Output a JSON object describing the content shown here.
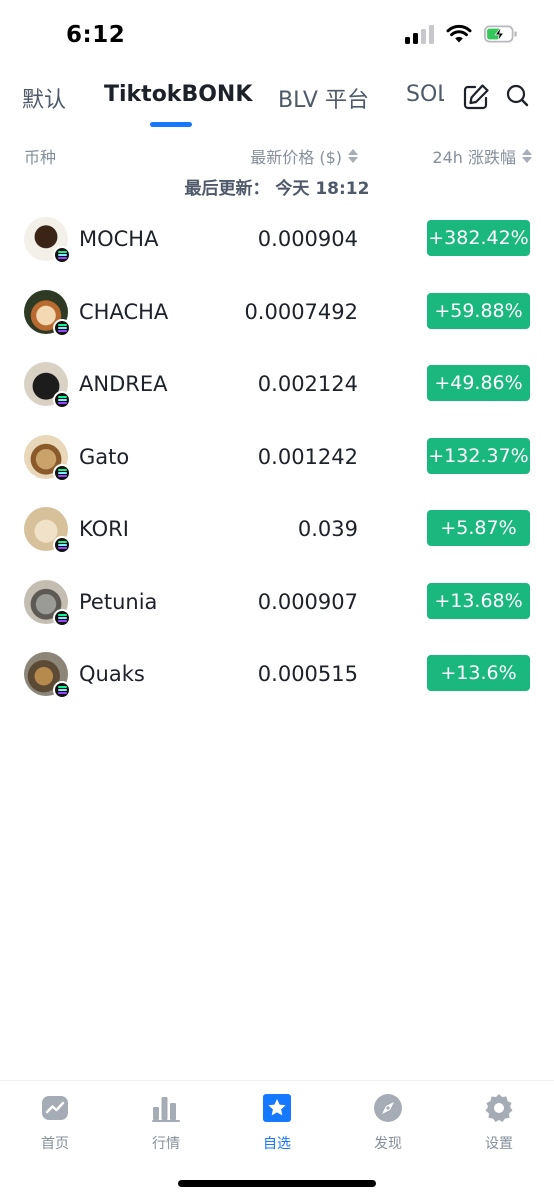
{
  "status_bar": {
    "time": "6:12"
  },
  "tabs": [
    {
      "label": "默认",
      "active": false
    },
    {
      "label": "TiktokBONK",
      "active": true
    },
    {
      "label": "BLV 平台",
      "active": false
    },
    {
      "label": "SOL",
      "active": false
    }
  ],
  "toolbar": {
    "edit_icon": "edit-icon",
    "search_icon": "search-icon"
  },
  "list_header": {
    "coin": "币种",
    "price": "最新价格 ($)",
    "change": "24h 涨跌幅"
  },
  "update_text": "最后更新：  今天 18:12",
  "coins": [
    {
      "name": "MOCHA",
      "price": "0.000904",
      "change": "+382.42%"
    },
    {
      "name": "CHACHA",
      "price": "0.0007492",
      "change": "+59.88%"
    },
    {
      "name": "ANDREA",
      "price": "0.002124",
      "change": "+49.86%"
    },
    {
      "name": "Gato",
      "price": "0.001242",
      "change": "+132.37%"
    },
    {
      "name": "KORI",
      "price": "0.039",
      "change": "+5.87%"
    },
    {
      "name": "Petunia",
      "price": "0.000907",
      "change": "+13.68%"
    },
    {
      "name": "Quaks",
      "price": "0.000515",
      "change": "+13.6%"
    }
  ],
  "bottom_nav": [
    {
      "label": "首页",
      "icon": "home-chart-icon",
      "active": false
    },
    {
      "label": "行情",
      "icon": "market-bars-icon",
      "active": false
    },
    {
      "label": "自选",
      "icon": "star-icon",
      "active": true
    },
    {
      "label": "发现",
      "icon": "compass-icon",
      "active": false
    },
    {
      "label": "设置",
      "icon": "gear-icon",
      "active": false
    }
  ],
  "colors": {
    "accent": "#1677ff",
    "up": "#1ab87f",
    "text": "#1d2129",
    "muted": "#86909c"
  }
}
